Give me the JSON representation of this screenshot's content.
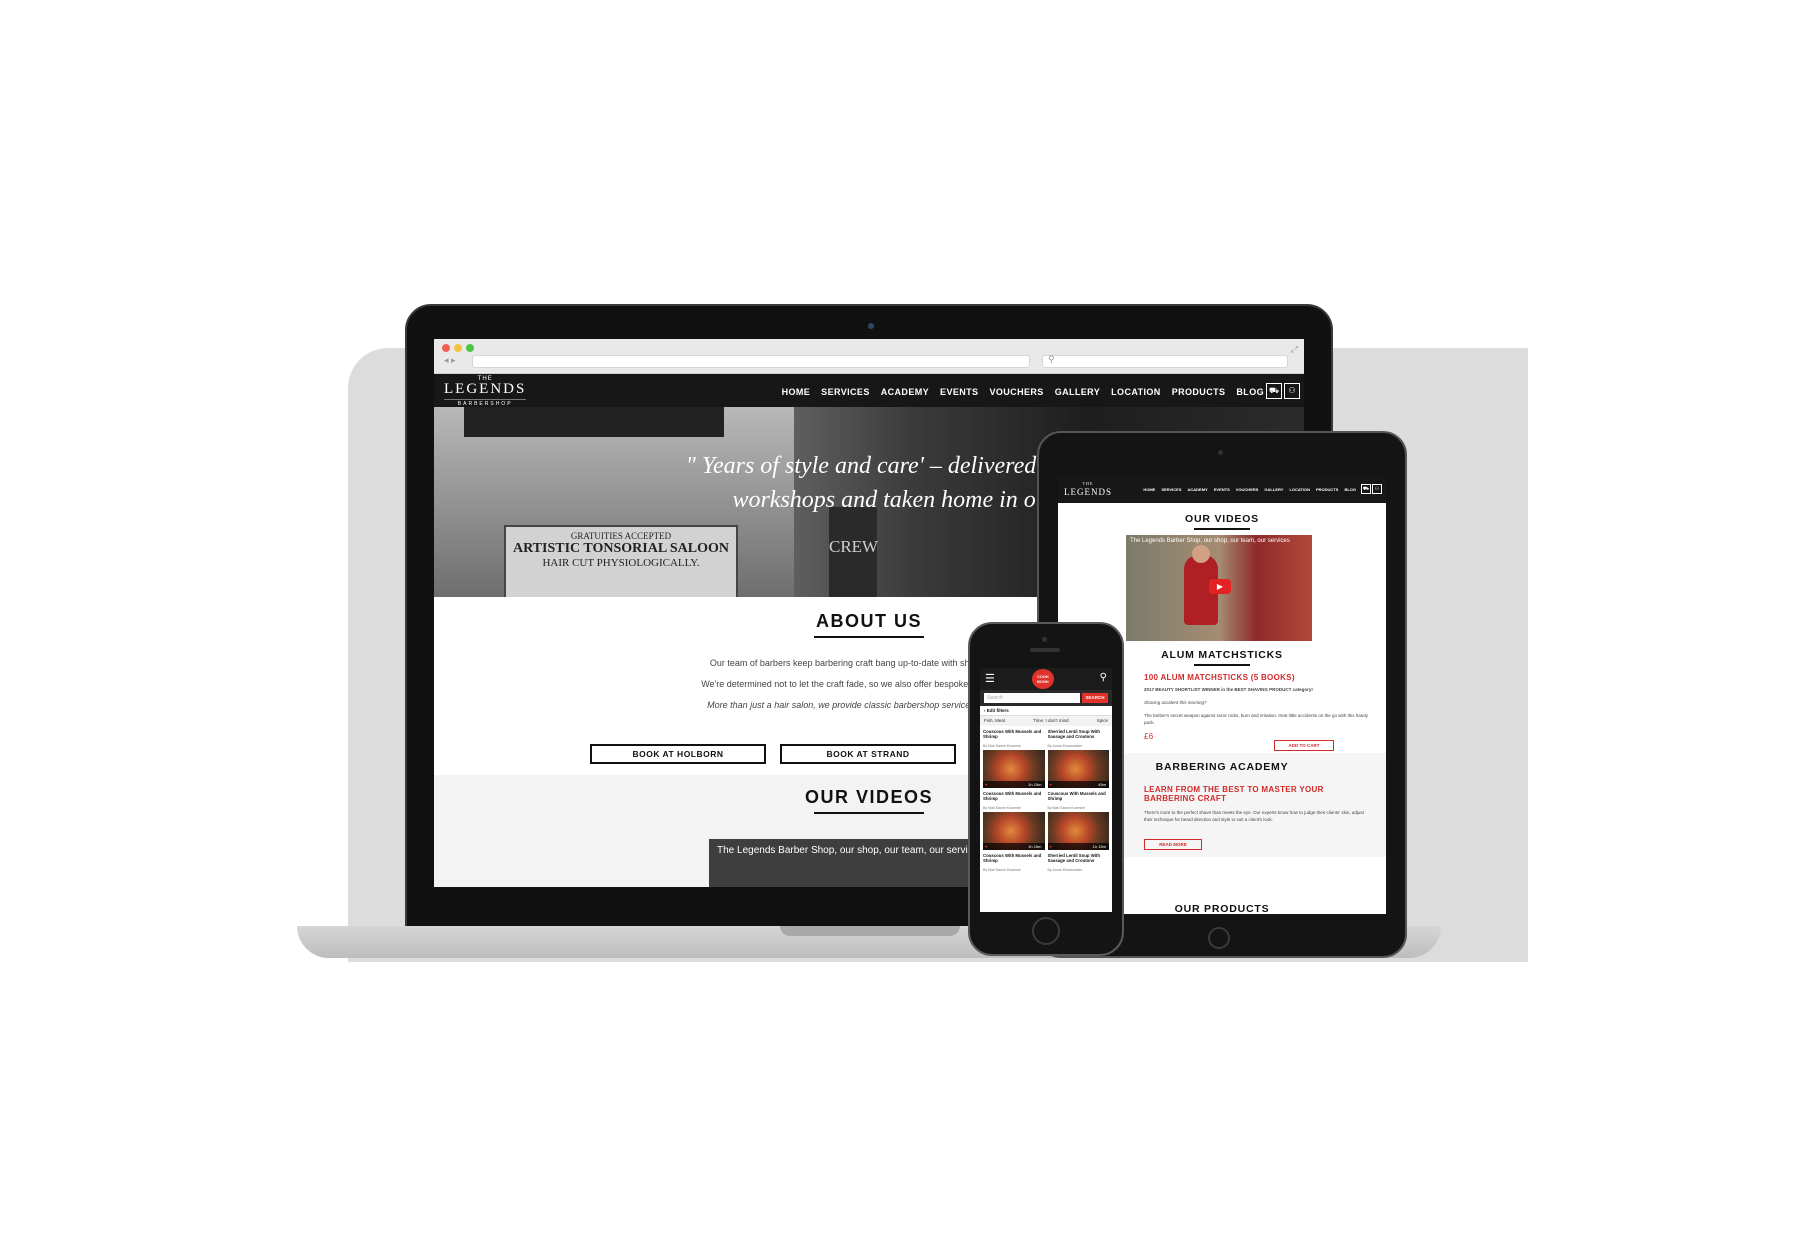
{
  "laptop": {
    "site": {
      "logo": {
        "the": "THE",
        "name": "LEGENDS",
        "sub": "BARBERSHOP"
      },
      "nav": [
        "HOME",
        "SERVICES",
        "ACADEMY",
        "EVENTS",
        "VOUCHERS",
        "GALLERY",
        "LOCATION",
        "PRODUCTS",
        "BLOG"
      ],
      "hero_quote_line1": "\" Years of style and care' – delivered at the salo",
      "hero_quote_line2": "workshops and taken home in our pro",
      "poster": {
        "gratuities": "GRATUITIES ACCEPTED",
        "saloon": "ARTISTIC TONSORIAL SALOON",
        "haircut": "HAIR CUT PHYSIOLOGICALLY.",
        "crew": "CREW"
      },
      "about": {
        "title": "ABOUT US",
        "p1": "Our team of barbers keep barbering craft bang up-to-date with sharp styling and",
        "p2": "We're determined not to let the craft fade, so we also offer bespoke courses, training",
        "p3": "More than just a hair salon, we provide classic barbershop service with legendary",
        "btn_holborn": "BOOK AT HOLBORN",
        "btn_strand": "BOOK AT STRAND"
      },
      "videos": {
        "title": "OUR VIDEOS",
        "caption": "The Legends Barber Shop, our shop, our team, our servi"
      }
    }
  },
  "tablet": {
    "logo": {
      "the": "THE",
      "name": "LEGENDS"
    },
    "nav": [
      "HOME",
      "SERVICES",
      "ACADEMY",
      "EVENTS",
      "VOUCHERS",
      "GALLERY",
      "LOCATION",
      "PRODUCTS",
      "BLOG"
    ],
    "videos_title": "OUR VIDEOS",
    "video_caption": "The Legends Barber Shop, our shop, our team, our services",
    "product_title": "ALUM MATCHSTICKS",
    "product_name": "100 ALUM MATCHSTICKS (5 BOOKS)",
    "product_award": "2017 BEAUTY SHORTLIST WINNER in the BEST SHAVING PRODUCT category!",
    "product_tag": "Shaving accident this morning?",
    "product_desc": "The barber's secret weapon against razor nicks, burn and irritation. treat little accidents on the go with this handy pack.",
    "price": "£6",
    "add_to_cart": "ADD TO CART",
    "academy_title": "BARBERING ACADEMY",
    "academy_headline": "LEARN FROM THE BEST TO MASTER YOUR BARBERING CRAFT",
    "academy_desc": "There's more to the perfect shave than meets the eye. Our experts know how to judge their clients' skin, adjust their technique for beard direction and style to suit a client's look.",
    "read_more": "READ MORE",
    "products_title": "OUR PRODUCTS"
  },
  "phone": {
    "brand": "COOK BOOK",
    "search_placeholder": "Search",
    "search_btn": "SEARCH",
    "edit_filters": "‹  Edit filters",
    "tags": [
      "Fish, Meat",
      "Time: I don't mind",
      "Spice"
    ],
    "cards": [
      {
        "title": "Couscous With Mussels and Shrimp",
        "by": "By Mari Sanne Kvamme",
        "time": "1h 15m"
      },
      {
        "title": "Sherried Lentil Soup With Sausage and Croutons",
        "by": "By Jonas Emanuelsen",
        "time": "45m"
      },
      {
        "title": "Couscous With Mussels and Shrimp",
        "by": "By Mari Sanne Kvamme",
        "time": "1h 15m"
      },
      {
        "title": "Couscous With Mussels and Shrimp",
        "by": "By Mari Sanne Kvamme",
        "time": "1h 15m"
      },
      {
        "title": "Couscous With Mussels and Shrimp",
        "by": "By Mari Sanne Kvamme",
        "time": "1h 15m"
      },
      {
        "title": "Sherried Lentil Soup With Sausage and Croutons",
        "by": "By Jonas Emanuelsen",
        "time": "45m"
      }
    ]
  },
  "colors": {
    "accent": "#d12a2a",
    "nav_bg": "#171717"
  },
  "icons": [
    "cart-icon",
    "user-icon",
    "menu-icon",
    "search-icon",
    "play-icon"
  ]
}
